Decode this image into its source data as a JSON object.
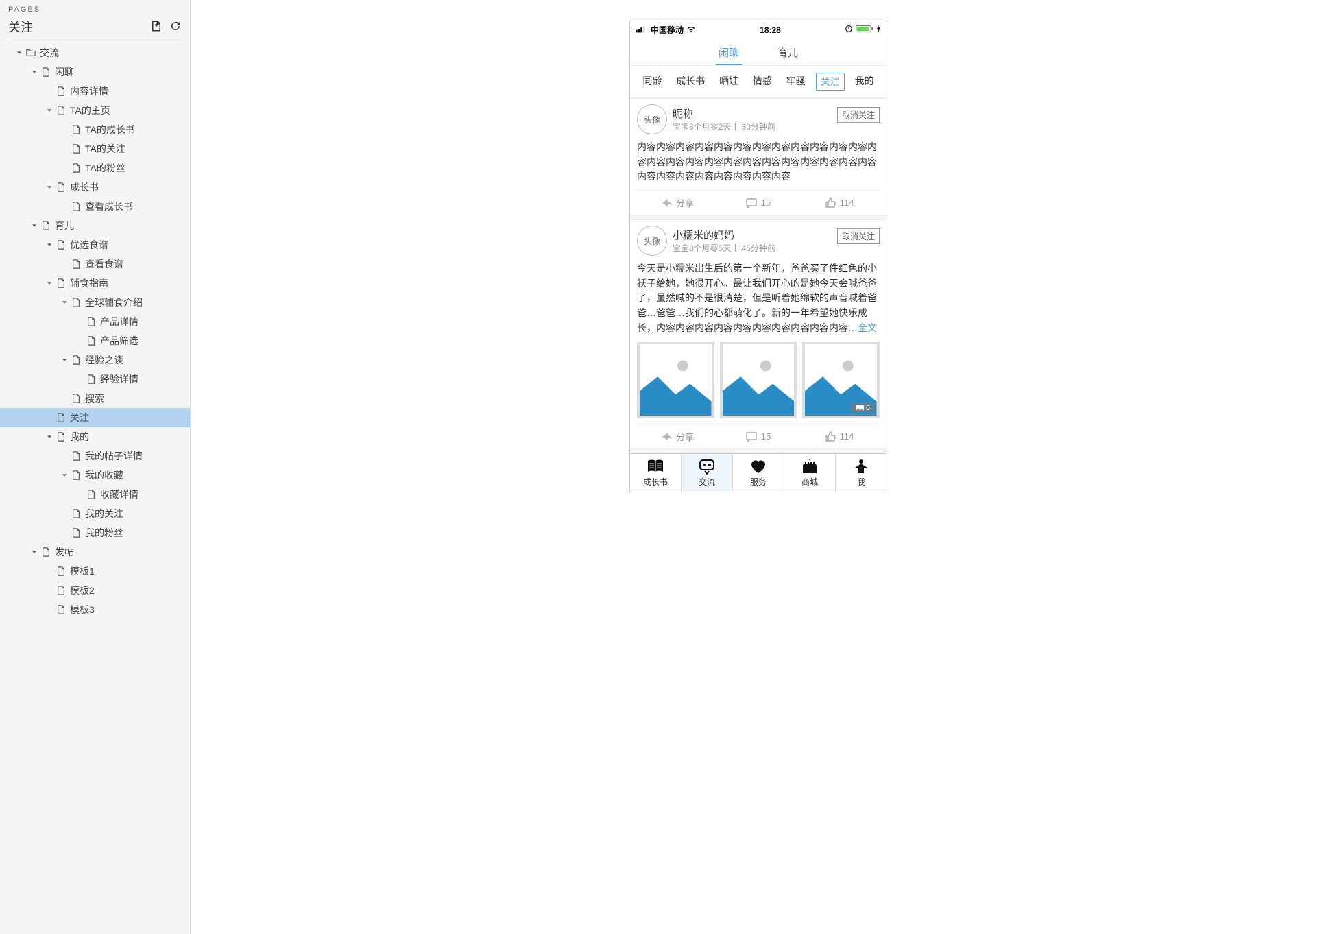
{
  "sidebar": {
    "section_label": "PAGES",
    "title": "关注",
    "tree": [
      {
        "indent": 0,
        "caret": true,
        "icon": "folder",
        "label": "交流"
      },
      {
        "indent": 1,
        "caret": true,
        "icon": "page",
        "label": "闲聊"
      },
      {
        "indent": 2,
        "caret": false,
        "icon": "page",
        "label": "内容详情"
      },
      {
        "indent": 2,
        "caret": true,
        "icon": "page",
        "label": "TA的主页"
      },
      {
        "indent": 3,
        "caret": false,
        "icon": "page",
        "label": "TA的成长书"
      },
      {
        "indent": 3,
        "caret": false,
        "icon": "page",
        "label": "TA的关注"
      },
      {
        "indent": 3,
        "caret": false,
        "icon": "page",
        "label": "TA的粉丝"
      },
      {
        "indent": 2,
        "caret": true,
        "icon": "page",
        "label": "成长书"
      },
      {
        "indent": 3,
        "caret": false,
        "icon": "page",
        "label": "查看成长书"
      },
      {
        "indent": 1,
        "caret": true,
        "icon": "page",
        "label": "育儿"
      },
      {
        "indent": 2,
        "caret": true,
        "icon": "page",
        "label": "优选食谱"
      },
      {
        "indent": 3,
        "caret": false,
        "icon": "page",
        "label": "查看食谱"
      },
      {
        "indent": 2,
        "caret": true,
        "icon": "page",
        "label": "辅食指南"
      },
      {
        "indent": 3,
        "caret": true,
        "icon": "page",
        "label": "全球辅食介绍"
      },
      {
        "indent": 4,
        "caret": false,
        "icon": "page",
        "label": "产品详情"
      },
      {
        "indent": 4,
        "caret": false,
        "icon": "page",
        "label": "产品筛选"
      },
      {
        "indent": 3,
        "caret": true,
        "icon": "page",
        "label": "经验之谈"
      },
      {
        "indent": 4,
        "caret": false,
        "icon": "page",
        "label": "经验详情"
      },
      {
        "indent": 3,
        "caret": false,
        "icon": "page",
        "label": "搜索"
      },
      {
        "indent": 2,
        "caret": false,
        "icon": "page",
        "label": "关注",
        "selected": true
      },
      {
        "indent": 2,
        "caret": true,
        "icon": "page",
        "label": "我的"
      },
      {
        "indent": 3,
        "caret": false,
        "icon": "page",
        "label": "我的帖子详情"
      },
      {
        "indent": 3,
        "caret": true,
        "icon": "page",
        "label": "我的收藏"
      },
      {
        "indent": 4,
        "caret": false,
        "icon": "page",
        "label": "收藏详情"
      },
      {
        "indent": 3,
        "caret": false,
        "icon": "page",
        "label": "我的关注"
      },
      {
        "indent": 3,
        "caret": false,
        "icon": "page",
        "label": "我的粉丝"
      },
      {
        "indent": 1,
        "caret": true,
        "icon": "page",
        "label": "发帖"
      },
      {
        "indent": 2,
        "caret": false,
        "icon": "page",
        "label": "模板1"
      },
      {
        "indent": 2,
        "caret": false,
        "icon": "page",
        "label": "模板2"
      },
      {
        "indent": 2,
        "caret": false,
        "icon": "page",
        "label": "模板3"
      }
    ]
  },
  "phone": {
    "status": {
      "carrier": "中国移动",
      "time": "18:28"
    },
    "top_tabs": [
      {
        "label": "闲聊",
        "active": true
      },
      {
        "label": "育儿",
        "active": false
      }
    ],
    "sub_tabs": [
      {
        "label": "同龄"
      },
      {
        "label": "成长书"
      },
      {
        "label": "晒娃"
      },
      {
        "label": "情感"
      },
      {
        "label": "牢骚"
      },
      {
        "label": "关注",
        "active": true
      },
      {
        "label": "我的"
      }
    ],
    "posts": [
      {
        "avatar": "头像",
        "name": "昵称",
        "meta": "宝宝8个月零2天丨 30分钟前",
        "unfollow": "取消关注",
        "body": "内容内容内容内容内容内容内容内容内容内容内容内容内容内容内容内容内容内容内容内容内容内容内容内容内容内容内容内容内容内容内容内容内容",
        "share": "分享",
        "comments": "15",
        "likes": "114"
      },
      {
        "avatar": "头像",
        "name": "小糯米的妈妈",
        "meta": "宝宝8个月零5天丨 45分钟前",
        "unfollow": "取消关注",
        "body": "今天是小糯米出生后的第一个新年，爸爸买了件红色的小袄子给她，她很开心。最让我们开心的是她今天会喊爸爸了，虽然喊的不是很清楚，但是听着她绵软的声音喊着爸爸…爸爸…我们的心都萌化了。新的一年希望她快乐成长，内容内容内容内容内容内容内容内容内容内容…",
        "more": "全文",
        "images": 3,
        "image_badge": "6",
        "share": "分享",
        "comments": "15",
        "likes": "114"
      }
    ],
    "bottom_nav": [
      {
        "label": "成长书",
        "icon": "book"
      },
      {
        "label": "交流",
        "icon": "chat",
        "active": true
      },
      {
        "label": "服务",
        "icon": "heart"
      },
      {
        "label": "商城",
        "icon": "castle"
      },
      {
        "label": "我",
        "icon": "person"
      }
    ]
  }
}
